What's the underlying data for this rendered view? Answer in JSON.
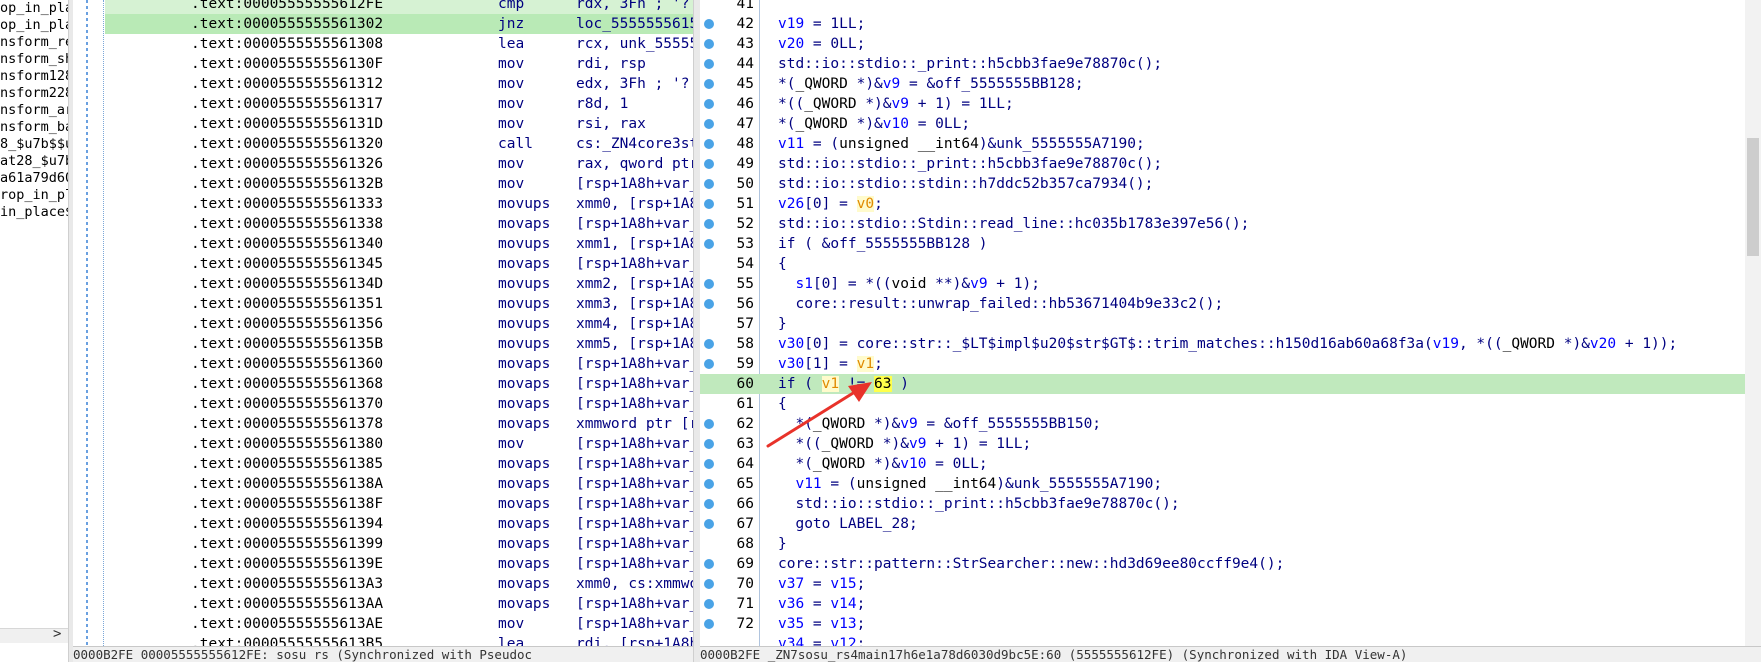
{
  "functions": {
    "items": [
      "op_in_pla",
      "op_in_pla",
      "nsform_re",
      "nsform_sh",
      "nsform128",
      "nsform228",
      "nsform_ar",
      "nsform_ba",
      "8_$u7b$$u",
      "at28_$u7b",
      "a61a79d60",
      "rop_in_pl",
      "in_place$"
    ],
    "scroll_arrow": ">"
  },
  "disasm": {
    "lines": [
      {
        "addr": ".text:00005555555612FE",
        "mn": "cmp",
        "op": "rdx, 3Fh ; '?'"
      },
      {
        "addr": ".text:0000555555561302",
        "mn": "jnz",
        "op": "loc_5555555615A"
      },
      {
        "addr": ".text:0000555555561308",
        "mn": "lea",
        "op": "rcx, unk_555555"
      },
      {
        "addr": ".text:000055555556130F",
        "mn": "mov",
        "op": "rdi, rsp"
      },
      {
        "addr": ".text:0000555555561312",
        "mn": "mov",
        "op": "edx, 3Fh ; '?'"
      },
      {
        "addr": ".text:0000555555561317",
        "mn": "mov",
        "op": "r8d, 1"
      },
      {
        "addr": ".text:000055555556131D",
        "mn": "mov",
        "op": "rsi, rax"
      },
      {
        "addr": ".text:0000555555561320",
        "mn": "call",
        "op": "cs:_ZN4core3str"
      },
      {
        "addr": ".text:0000555555561326",
        "mn": "mov",
        "op": "rax, qword ptr"
      },
      {
        "addr": ".text:000055555556132B",
        "mn": "mov",
        "op": "[rsp+1A8h+var_3"
      },
      {
        "addr": ".text:0000555555561333",
        "mn": "movups",
        "op": "xmm0, [rsp+1A8h"
      },
      {
        "addr": ".text:0000555555561338",
        "mn": "movaps",
        "op": "[rsp+1A8h+var_4"
      },
      {
        "addr": ".text:0000555555561340",
        "mn": "movups",
        "op": "xmm1, [rsp+1A8h"
      },
      {
        "addr": ".text:0000555555561345",
        "mn": "movaps",
        "op": "[rsp+1A8h+var_5"
      },
      {
        "addr": ".text:000055555556134D",
        "mn": "movups",
        "op": "xmm2, [rsp+1A8h"
      },
      {
        "addr": ".text:0000555555561351",
        "mn": "movups",
        "op": "xmm3, [rsp+1A8h"
      },
      {
        "addr": ".text:0000555555561356",
        "mn": "movups",
        "op": "xmm4, [rsp+1A8h"
      },
      {
        "addr": ".text:000055555556135B",
        "mn": "movups",
        "op": "xmm5, [rsp+1A8h"
      },
      {
        "addr": ".text:0000555555561360",
        "mn": "movaps",
        "op": "[rsp+1A8h+var_6"
      },
      {
        "addr": ".text:0000555555561368",
        "mn": "movaps",
        "op": "[rsp+1A8h+var_7"
      },
      {
        "addr": ".text:0000555555561370",
        "mn": "movaps",
        "op": "[rsp+1A8h+var_8"
      },
      {
        "addr": ".text:0000555555561378",
        "mn": "movaps",
        "op": "xmmword ptr [rs"
      },
      {
        "addr": ".text:0000555555561380",
        "mn": "mov",
        "op": "[rsp+1A8h+var_1"
      },
      {
        "addr": ".text:0000555555561385",
        "mn": "movaps",
        "op": "[rsp+1A8h+var_1"
      },
      {
        "addr": ".text:000055555556138A",
        "mn": "movaps",
        "op": "[rsp+1A8h+var_1"
      },
      {
        "addr": ".text:000055555556138F",
        "mn": "movaps",
        "op": "[rsp+1A8h+var_1"
      },
      {
        "addr": ".text:0000555555561394",
        "mn": "movaps",
        "op": "[rsp+1A8h+var_1"
      },
      {
        "addr": ".text:0000555555561399",
        "mn": "movaps",
        "op": "[rsp+1A8h+var_1"
      },
      {
        "addr": ".text:000055555556139E",
        "mn": "movaps",
        "op": "[rsp+1A8h+var_1"
      },
      {
        "addr": ".text:00005555555613A3",
        "mn": "movaps",
        "op": "xmm0, cs:xmmwor"
      },
      {
        "addr": ".text:00005555555613AA",
        "mn": "movaps",
        "op": "[rsp+1A8h+var_1"
      },
      {
        "addr": ".text:00005555555613AE",
        "mn": "mov",
        "op": "[rsp+1A8h+var_1"
      },
      {
        "addr": ".text:00005555555613B5",
        "mn": "lea",
        "op": "rdi, [rsp+1A8h+"
      }
    ],
    "status": "0000B2FE 00005555555612FE: sosu rs (Synchronized with Pseudoc"
  },
  "pseudocode": {
    "lines": [
      {
        "num": "41",
        "bp": false,
        "html": ""
      },
      {
        "num": "42",
        "bp": true,
        "html": "<span class=\"v\">v19</span> = 1LL;"
      },
      {
        "num": "43",
        "bp": true,
        "html": "<span class=\"v\">v20</span> = 0LL;"
      },
      {
        "num": "44",
        "bp": true,
        "html": "std::io::stdio::_print::h5cbb3fae9e78870c();"
      },
      {
        "num": "45",
        "bp": true,
        "html": "*(<span class=\"n\">_QWORD</span> *)&amp;<span class=\"v\">v9</span> = &amp;off_5555555BB128;"
      },
      {
        "num": "46",
        "bp": true,
        "html": "*((<span class=\"n\">_QWORD</span> *)&amp;<span class=\"v\">v9</span> + 1) = 1LL;"
      },
      {
        "num": "47",
        "bp": true,
        "html": "*(<span class=\"n\">_QWORD</span> *)&amp;<span class=\"v\">v10</span> = 0LL;"
      },
      {
        "num": "48",
        "bp": true,
        "html": "<span class=\"v\">v11</span> = (<span class=\"n\">unsigned __int64</span>)&amp;unk_5555555A7190;"
      },
      {
        "num": "49",
        "bp": true,
        "html": "std::io::stdio::_print::h5cbb3fae9e78870c();"
      },
      {
        "num": "50",
        "bp": true,
        "html": "std::io::stdio::stdin::h7ddc52b357ca7934();"
      },
      {
        "num": "51",
        "bp": true,
        "html": "<span class=\"v\">v26</span>[0] = <span class=\"vh\">v0</span>;"
      },
      {
        "num": "52",
        "bp": true,
        "html": "std::io::stdio::Stdin::read_line::hc035b1783e397e56();"
      },
      {
        "num": "53",
        "bp": true,
        "html": "if ( &amp;off_5555555BB128 )"
      },
      {
        "num": "54",
        "bp": false,
        "html": "{"
      },
      {
        "num": "55",
        "bp": true,
        "html": "  <span class=\"v\">s1</span>[0] = *((<span class=\"n\">void</span> **)&amp;<span class=\"v\">v9</span> + 1);"
      },
      {
        "num": "56",
        "bp": true,
        "html": "  core::result::unwrap_failed::hb53671404b9e33c2();"
      },
      {
        "num": "57",
        "bp": false,
        "html": "}"
      },
      {
        "num": "58",
        "bp": true,
        "html": "<span class=\"v\">v30</span>[0] = core::str::_$LT$impl$u20$str$GT$::trim_matches::h150d16ab60a68f3a(<span class=\"v\">v19</span>, *((<span class=\"n\">_QWORD</span> *)&amp;<span class=\"v\">v20</span> + 1));"
      },
      {
        "num": "59",
        "bp": true,
        "html": "<span class=\"v\">v30</span>[1] = <span class=\"vh\">v1</span>;"
      },
      {
        "num": "60",
        "bp": true,
        "html": "if ( <span class=\"vh\">v1</span> != <span class=\"hl-num\">63</span> )",
        "hl": true
      },
      {
        "num": "61",
        "bp": false,
        "html": "{"
      },
      {
        "num": "62",
        "bp": true,
        "html": "  *(<span class=\"n\">_QWORD</span> *)&amp;<span class=\"v\">v9</span> = &amp;off_5555555BB150;"
      },
      {
        "num": "63",
        "bp": true,
        "html": "  *((<span class=\"n\">_QWORD</span> *)&amp;<span class=\"v\">v9</span> + 1) = 1LL;"
      },
      {
        "num": "64",
        "bp": true,
        "html": "  *(<span class=\"n\">_QWORD</span> *)&amp;<span class=\"v\">v10</span> = 0LL;"
      },
      {
        "num": "65",
        "bp": true,
        "html": "  <span class=\"v\">v11</span> = (<span class=\"n\">unsigned __int64</span>)&amp;unk_5555555A7190;"
      },
      {
        "num": "66",
        "bp": true,
        "html": "  std::io::stdio::_print::h5cbb3fae9e78870c();"
      },
      {
        "num": "67",
        "bp": true,
        "html": "  goto LABEL_28;"
      },
      {
        "num": "68",
        "bp": false,
        "html": "}"
      },
      {
        "num": "69",
        "bp": true,
        "html": "core::str::pattern::StrSearcher::new::hd3d69ee80ccff9e4();"
      },
      {
        "num": "70",
        "bp": true,
        "html": "<span class=\"v\">v37</span> = <span class=\"v\">v15</span>;"
      },
      {
        "num": "71",
        "bp": true,
        "html": "<span class=\"v\">v36</span> = <span class=\"v\">v14</span>;"
      },
      {
        "num": "72",
        "bp": true,
        "html": "<span class=\"v\">v35</span> = <span class=\"v\">v13</span>;"
      },
      {
        "num": "",
        "bp": false,
        "html": "<span class=\"v\">v34</span> = <span class=\"v\">v12</span>;"
      }
    ],
    "status": "0000B2FE _ZN7sosu_rs4main17h6e1a78d6030d9bc5E:60 (5555555612FE) (Synchronized with IDA View-A)"
  },
  "colors": {
    "highlight_line": "#c0e9bd",
    "breakpoint": "#4aa3e6",
    "annotation_arrow": "#e8322a"
  }
}
